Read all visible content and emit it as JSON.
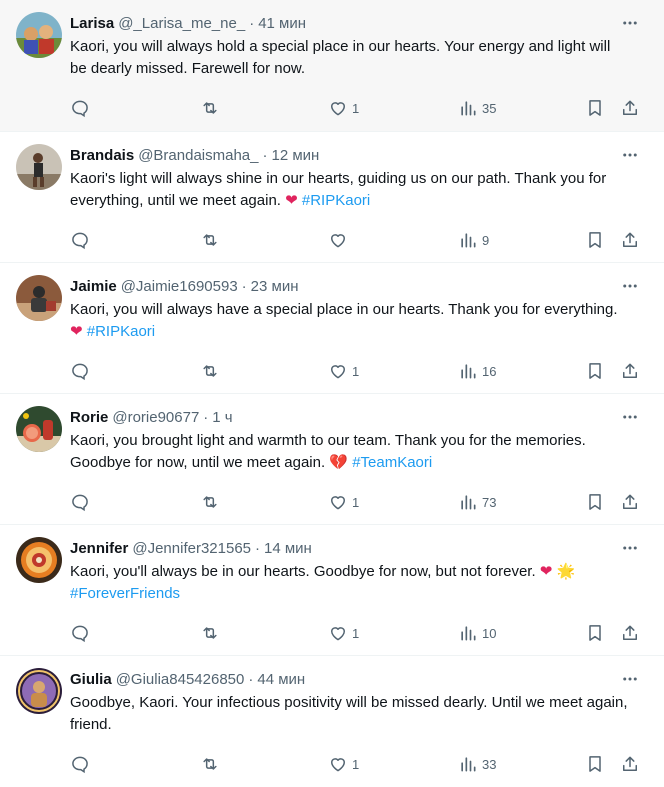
{
  "colors": {
    "text": "#0f1419",
    "muted": "#536471",
    "link": "#1d9bf0",
    "heart": "#e0245e",
    "hover_bg": "#f7f7f7"
  },
  "tweets": [
    {
      "name": "Larisa",
      "handle": "@_Larisa_me_ne_",
      "dot": "·",
      "time": "41 мин",
      "text": "Kaori, you will always hold a special place in our hearts. Your energy and light will be dearly missed. Farewell for now.",
      "emoji": "",
      "hashtag": "",
      "likes": "1",
      "views": "35"
    },
    {
      "name": "Brandais",
      "handle": "@Brandaismaha_",
      "dot": "·",
      "time": "12 мин",
      "text": "Kaori's light will always shine in our hearts, guiding us on our path. Thank you for everything, until we meet again.",
      "emoji": "❤",
      "hashtag": "#RIPKaori",
      "likes": "",
      "views": "9"
    },
    {
      "name": "Jaimie",
      "handle": "@Jaimie1690593",
      "dot": "·",
      "time": "23 мин",
      "text": "Kaori, you will always have a special place in our hearts. Thank you for everything.",
      "emoji": "❤",
      "hashtag": "#RIPKaori",
      "likes": "1",
      "views": "16"
    },
    {
      "name": "Rorie",
      "handle": "@rorie90677",
      "dot": "·",
      "time": "1 ч",
      "text": "Kaori, you brought light and warmth to our team. Thank you for the memories. Goodbye for now, until we meet again.",
      "emoji": "💔",
      "hashtag": "#TeamKaori",
      "likes": "1",
      "views": "73"
    },
    {
      "name": "Jennifer",
      "handle": "@Jennifer321565",
      "dot": "·",
      "time": "14 мин",
      "text": "Kaori, you'll always be in our hearts. Goodbye for now, but not forever.",
      "emoji": "❤ 🌟",
      "hashtag": "#ForeverFriends",
      "likes": "1",
      "views": "10"
    },
    {
      "name": "Giulia",
      "handle": "@Giulia845426850",
      "dot": "·",
      "time": "44 мин",
      "text": "Goodbye, Kaori. Your infectious positivity will be missed dearly. Until we meet again, friend.",
      "emoji": "",
      "hashtag": "",
      "likes": "1",
      "views": "33"
    }
  ]
}
